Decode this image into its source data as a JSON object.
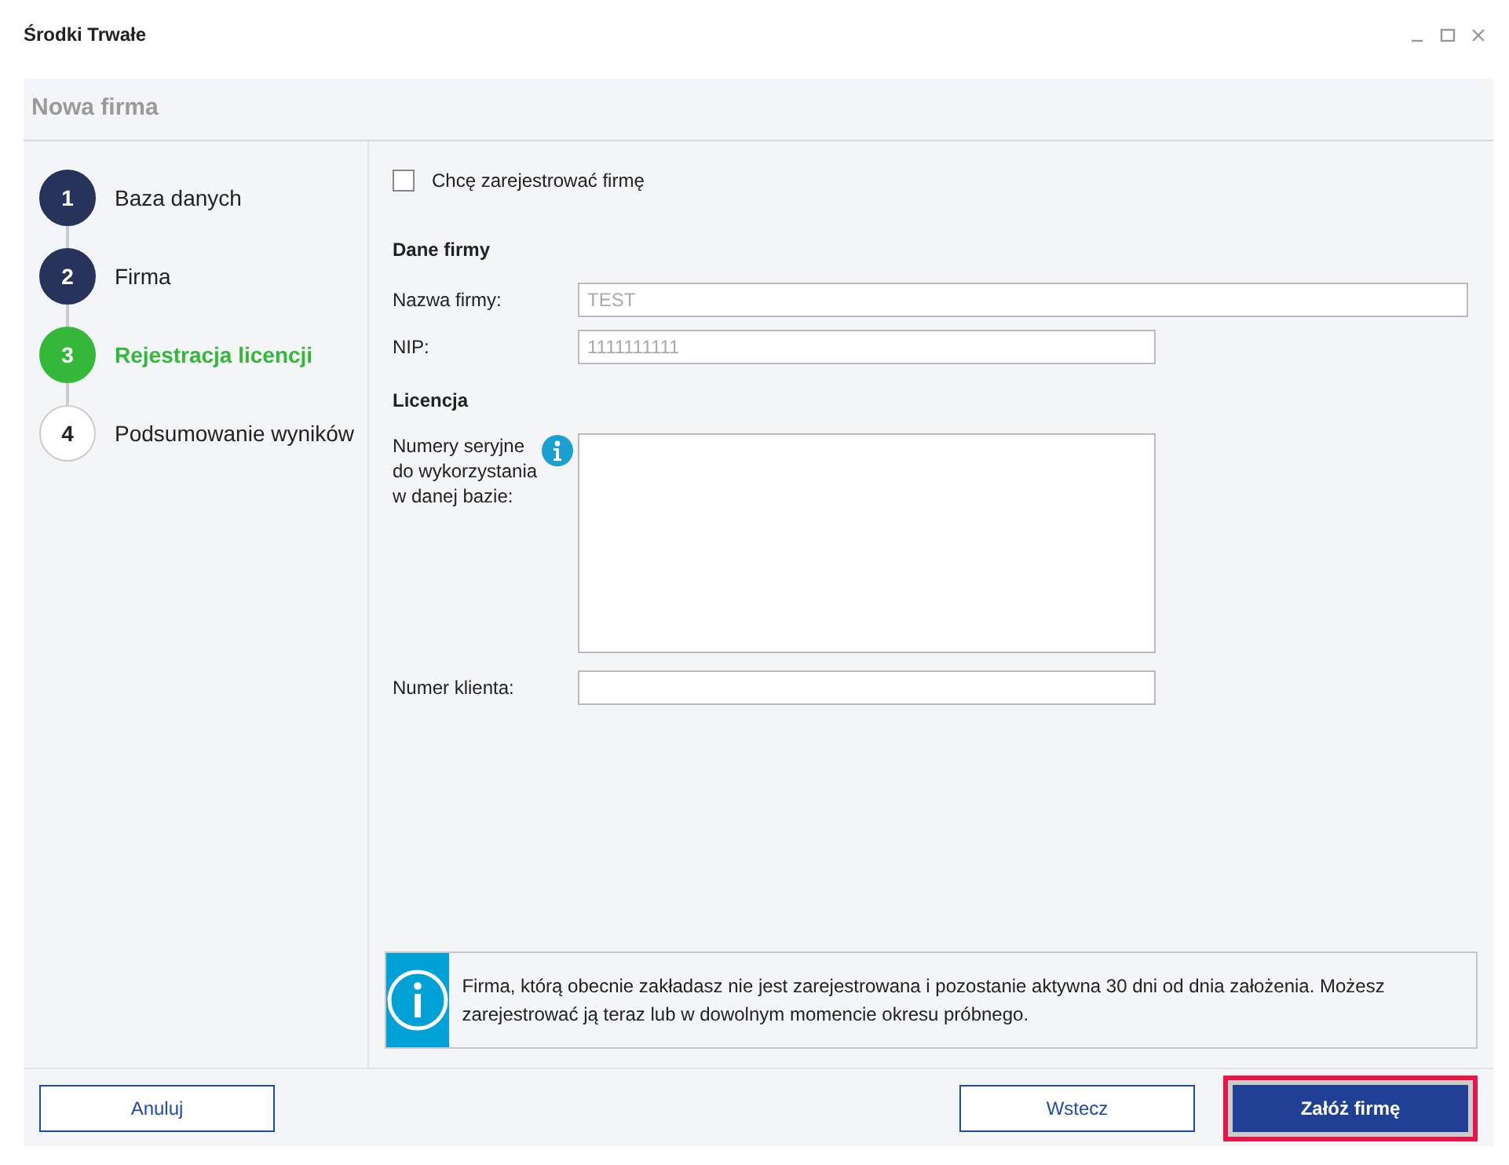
{
  "window": {
    "title": "Środki Trwałe"
  },
  "header": {
    "title": "Nowa firma"
  },
  "steps": [
    {
      "number": "1",
      "label": "Baza danych",
      "completed": true,
      "selected": false
    },
    {
      "number": "2",
      "label": "Firma",
      "completed": true,
      "selected": false
    },
    {
      "number": "3",
      "label": "Rejestracja licencji",
      "completed": false,
      "selected": true
    },
    {
      "number": "4",
      "label": "Podsumowanie wyników",
      "completed": false,
      "selected": false
    }
  ],
  "register_checkbox": {
    "label": "Chcę zarejestrować firmę",
    "checked": false
  },
  "company_section": {
    "title": "Dane firmy",
    "fields": [
      {
        "label": "Nazwa firmy:",
        "value": "TEST",
        "disabled": true,
        "wide": true
      },
      {
        "label": "NIP:",
        "value": "1111111111",
        "disabled": true,
        "wide": false
      }
    ]
  },
  "license_section": {
    "title": "Licencja",
    "serials_label": "Numery seryjne do wykorzystania w danej bazie:",
    "client_label": "Numer klienta:"
  },
  "notice": {
    "text": "Firma, którą obecnie zakładasz nie jest zarejestrowana i pozostanie aktywna 30 dni od dnia założenia. Możesz zarejestrować ją teraz lub w dowolnym momencie okresu próbnego."
  },
  "buttons": {
    "cancel": "Anuluj",
    "back": "Wstecz",
    "create": "Załóż firmę"
  }
}
